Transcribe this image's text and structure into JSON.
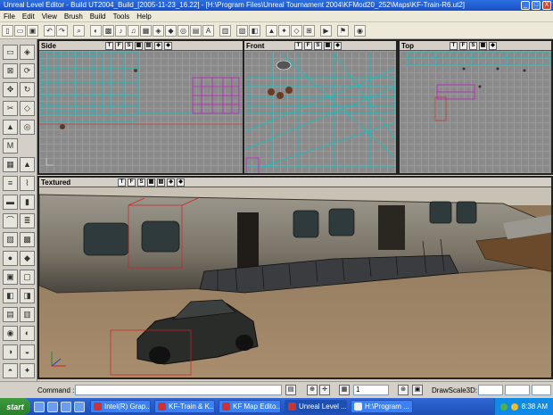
{
  "window": {
    "title": "Unreal Level Editor - Build UT2004_Build_[2005-11-23_16.22] - [H:\\Program Files\\Unreal Tournament 2004\\KFMod20_252\\Maps\\KF-Train-R6.ut2]",
    "minimize": "_",
    "maximize": "□",
    "close": "X"
  },
  "menu": [
    "File",
    "Edit",
    "View",
    "Brush",
    "Build",
    "Tools",
    "Help"
  ],
  "viewports": {
    "side": {
      "label": "Side"
    },
    "front": {
      "label": "Front"
    },
    "top": {
      "label": "Top"
    },
    "textured": {
      "label": "Textured"
    }
  },
  "viewport_buttons": [
    "T",
    "F",
    "S"
  ],
  "command": {
    "label": "Command :",
    "value": "",
    "grid_select": "1",
    "drawscale_label": "DrawScale3D:"
  },
  "taskbar": {
    "start": "start",
    "tasks": [
      {
        "label": "Intel(R) Grap..."
      },
      {
        "label": "KF-Train & K..."
      },
      {
        "label": "KF Map Edito..."
      },
      {
        "label": "Unreal Level ..."
      },
      {
        "label": "H:\\Program ..."
      }
    ],
    "clock": "8:38 AM"
  },
  "colors": {
    "titlebar": "#2b6fe0",
    "wireframe": "#00c8c8",
    "selected_brush": "#c020c0",
    "taskbar": "#3168d5"
  }
}
